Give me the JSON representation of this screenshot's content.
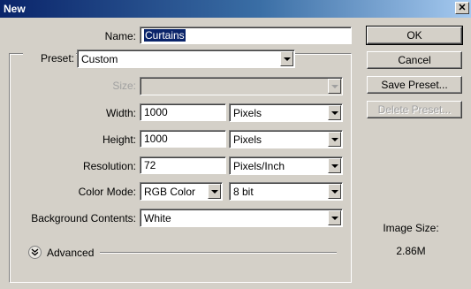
{
  "window": {
    "title": "New",
    "close_glyph": "✕"
  },
  "name": {
    "label": "Name:",
    "value": "Curtains"
  },
  "preset": {
    "label": "Preset:",
    "value": "Custom"
  },
  "size": {
    "label": "Size:",
    "value": ""
  },
  "width": {
    "label": "Width:",
    "value": "1000",
    "unit": "Pixels"
  },
  "height": {
    "label": "Height:",
    "value": "1000",
    "unit": "Pixels"
  },
  "resolution": {
    "label": "Resolution:",
    "value": "72",
    "unit": "Pixels/Inch"
  },
  "color_mode": {
    "label": "Color Mode:",
    "mode": "RGB Color",
    "depth": "8 bit"
  },
  "background": {
    "label": "Background Contents:",
    "value": "White"
  },
  "advanced": {
    "label": "Advanced",
    "icon": "chevron-double-down-icon"
  },
  "buttons": {
    "ok": "OK",
    "cancel": "Cancel",
    "save_preset": "Save Preset...",
    "delete_preset": "Delete Preset..."
  },
  "image_size": {
    "label": "Image Size:",
    "value": "2.86M"
  },
  "colors": {
    "titlebar": "#0a246a",
    "dialog": "#d4d0c8",
    "selection": "#0a246a"
  }
}
